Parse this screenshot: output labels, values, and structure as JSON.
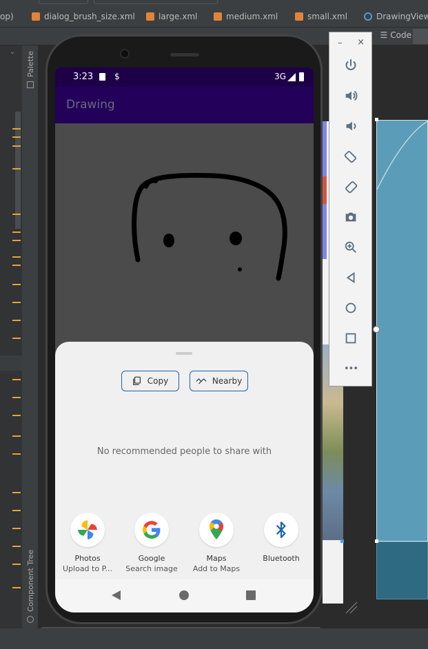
{
  "ide": {
    "tabs": [
      {
        "label": "op)",
        "icon": "none-icon"
      },
      {
        "label": "dialog_brush_size.xml",
        "icon": "xml-file-icon"
      },
      {
        "label": "large.xml",
        "icon": "xml-file-icon"
      },
      {
        "label": "medium.xml",
        "icon": "xml-file-icon"
      },
      {
        "label": "small.xml",
        "icon": "xml-file-icon"
      },
      {
        "label": "DrawingView.k",
        "icon": "kotlin-file-icon"
      }
    ],
    "code_label": "Code",
    "palette_label": "Palette",
    "component_tree_label": "Component Tree"
  },
  "emulator": {
    "minimize_label": "–",
    "close_label": "×",
    "buttons": [
      "power-icon",
      "volume-up-icon",
      "volume-down-icon",
      "rotate-left-icon",
      "rotate-right-icon",
      "camera-icon",
      "zoom-icon",
      "back-icon",
      "home-icon",
      "overview-icon",
      "more-icon"
    ],
    "more_label": "•••"
  },
  "phone": {
    "status": {
      "time": "3:23",
      "network": "3G"
    },
    "app_title": "Drawing",
    "share_sheet": {
      "copy_label": "Copy",
      "nearby_label": "Nearby",
      "empty_message": "No recommended people to share with",
      "targets": [
        {
          "name": "Photos",
          "sub": "Upload to P...",
          "icon": "google-photos-icon"
        },
        {
          "name": "Google",
          "sub": "Search image",
          "icon": "google-icon"
        },
        {
          "name": "Maps",
          "sub": "Add to Maps",
          "icon": "google-maps-icon"
        },
        {
          "name": "Bluetooth",
          "sub": "",
          "icon": "bluetooth-icon"
        }
      ]
    }
  },
  "colors": {
    "status_bar": "#1d0048",
    "app_bar": "#23005a",
    "canvas": "#4b4b4b",
    "accent_blue": "#1a5fb4"
  }
}
